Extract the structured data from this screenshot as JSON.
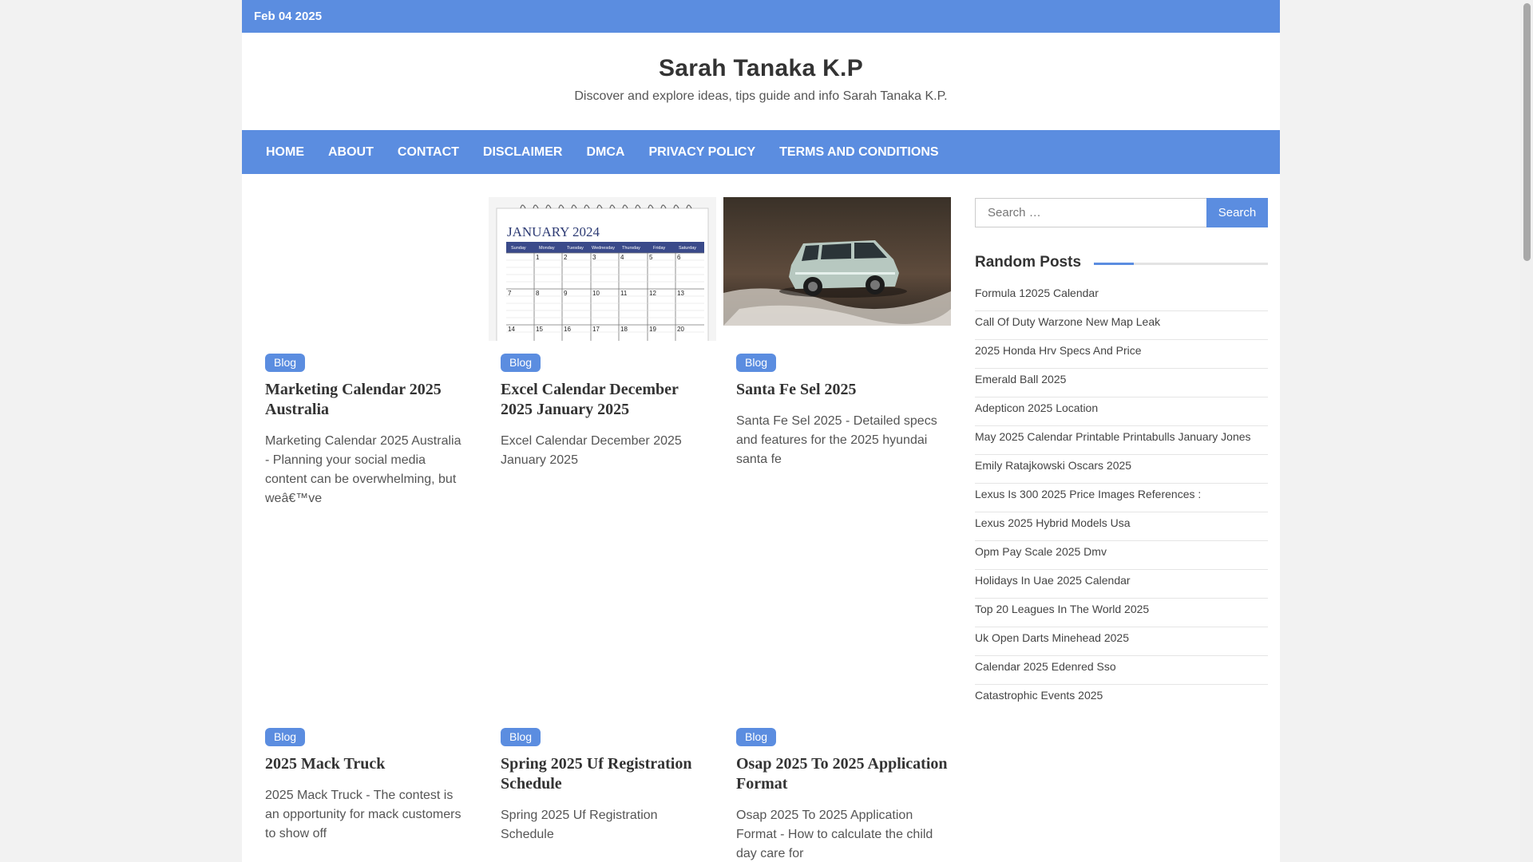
{
  "topbar": {
    "date": "Feb 04 2025"
  },
  "site": {
    "title": "Sarah Tanaka K.P",
    "description": "Discover and explore ideas, tips guide and info Sarah Tanaka K.P."
  },
  "nav": [
    "HOME",
    "ABOUT",
    "CONTACT",
    "DISCLAIMER",
    "DMCA",
    "PRIVACY POLICY",
    "TERMS AND CONDITIONS"
  ],
  "posts": [
    {
      "category": "Blog",
      "title": "Marketing Calendar 2025 Australia",
      "excerpt": "Marketing Calendar 2025 Australia - Planning your social media content can be overwhelming, but weâ€™ve"
    },
    {
      "category": "Blog",
      "title": "Excel Calendar December 2025 January 2025",
      "excerpt": "Excel Calendar December 2025 January 2025",
      "image": {
        "month_label": "JANUARY 2024",
        "weekdays": [
          "Sunday",
          "Monday",
          "Tuesday",
          "Wednesday",
          "Thursday",
          "Friday",
          "Saturday"
        ]
      }
    },
    {
      "category": "Blog",
      "title": "Santa Fe Sel 2025",
      "excerpt": "Santa Fe Sel 2025 - Detailed specs and features for the 2025 hyundai santa fe"
    },
    {
      "category": "Blog",
      "title": "2025 Mack Truck",
      "excerpt": "2025 Mack Truck - The contest is an opportunity for mack customers to show off"
    },
    {
      "category": "Blog",
      "title": "Spring 2025 Uf Registration Schedule",
      "excerpt": "Spring 2025 Uf Registration Schedule"
    },
    {
      "category": "Blog",
      "title": "Osap 2025 To 2025 Application Format",
      "excerpt": "Osap 2025 To 2025 Application Format - How to calculate the child day care for"
    }
  ],
  "sidebar": {
    "search_placeholder": "Search …",
    "search_button": "Search",
    "random_title": "Random Posts",
    "random_posts": [
      "Formula 12025 Calendar",
      "Call Of Duty Warzone New Map Leak",
      "2025 Honda Hrv Specs And Price",
      "Emerald Ball 2025",
      "Adepticon 2025 Location",
      "May 2025 Calendar Printable Printabulls January Jones",
      "Emily Ratajkowski Oscars 2025",
      "Lexus Is 300 2025 Price Images References :",
      "Lexus 2025 Hybrid Models Usa",
      "Opm Pay Scale 2025 Dmv",
      "Holidays In Uae 2025 Calendar",
      "Top 20 Leagues In The World 2025",
      "Uk Open Darts Minehead 2025",
      "Calendar 2025 Edenred Sso",
      "Catastrophic Events 2025"
    ]
  },
  "colors": {
    "accent": "#5b8de0",
    "background": "#f2f2f2"
  },
  "icons": {
    "search": "search-icon"
  }
}
